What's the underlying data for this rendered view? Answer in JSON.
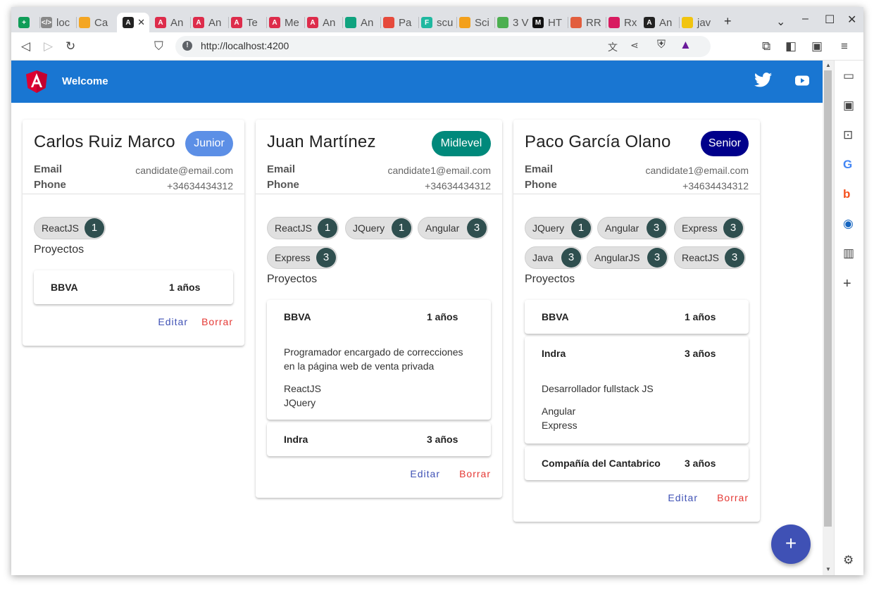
{
  "browser": {
    "tabs": [
      {
        "label": "",
        "color": "#0f9d58",
        "glyph": "+"
      },
      {
        "label": "loc",
        "color": "#888888",
        "glyph": "</>"
      },
      {
        "label": "Ca",
        "color": "#f4a623",
        "glyph": ""
      },
      {
        "label": "",
        "color": "#222222",
        "glyph": "A",
        "active": true
      },
      {
        "label": "An",
        "color": "#dd2c4b",
        "glyph": "A"
      },
      {
        "label": "An",
        "color": "#dd2c4b",
        "glyph": "A"
      },
      {
        "label": "Te",
        "color": "#dd2c4b",
        "glyph": "A"
      },
      {
        "label": "Me",
        "color": "#dd2c4b",
        "glyph": "A"
      },
      {
        "label": "An",
        "color": "#dd2c4b",
        "glyph": "A"
      },
      {
        "label": "An",
        "color": "#10a37f",
        "glyph": ""
      },
      {
        "label": "Pa",
        "color": "#e64a3c",
        "glyph": ""
      },
      {
        "label": "scu",
        "color": "#1fb8a0",
        "glyph": "F"
      },
      {
        "label": "Sci",
        "color": "#f3a01b",
        "glyph": ""
      },
      {
        "label": "3 V",
        "color": "#4caf50",
        "glyph": ""
      },
      {
        "label": "HT",
        "color": "#111111",
        "glyph": "M"
      },
      {
        "label": "RR",
        "color": "#e25e3e",
        "glyph": ""
      },
      {
        "label": "Rx",
        "color": "#d81b60",
        "glyph": ""
      },
      {
        "label": "An",
        "color": "#222222",
        "glyph": "A"
      },
      {
        "label": "jav",
        "color": "#f1c40f",
        "glyph": ""
      }
    ],
    "new_tab": "+",
    "url": "http://localhost:4200"
  },
  "app": {
    "title": "Welcome",
    "fab_label": "+"
  },
  "candidates": [
    {
      "name": "Carlos Ruiz Marco",
      "level": "Junior",
      "level_color": "#5c8fe6",
      "email_label": "Email",
      "email": "candidate@email.com",
      "phone_label": "Phone",
      "phone": "+34634434312",
      "skills": [
        {
          "name": "ReactJS",
          "years": "1"
        }
      ],
      "projects_title": "Proyectos",
      "projects": [
        {
          "name": "BBVA",
          "years": "1 años",
          "description": "",
          "tech": []
        }
      ],
      "edit_label": "Editar",
      "delete_label": "Borrar"
    },
    {
      "name": "Juan Martínez",
      "level": "Midlevel",
      "level_color": "#00897b",
      "email_label": "Email",
      "email": "candidate1@email.com",
      "phone_label": "Phone",
      "phone": "+34634434312",
      "skills": [
        {
          "name": "ReactJS",
          "years": "1"
        },
        {
          "name": "JQuery",
          "years": "1"
        },
        {
          "name": "Angular",
          "years": "3"
        },
        {
          "name": "Express",
          "years": "3"
        }
      ],
      "projects_title": "Proyectos",
      "projects": [
        {
          "name": "BBVA",
          "years": "1 años",
          "description": "Programador encargado de correcciones en la página web de venta privada",
          "tech": [
            "ReactJS",
            "JQuery"
          ]
        },
        {
          "name": "Indra",
          "years": "3 años",
          "description": "",
          "tech": []
        }
      ],
      "edit_label": "Editar",
      "delete_label": "Borrar"
    },
    {
      "name": "Paco García Olano",
      "level": "Senior",
      "level_color": "#00008b",
      "email_label": "Email",
      "email": "candidate1@email.com",
      "phone_label": "Phone",
      "phone": "+34634434312",
      "skills": [
        {
          "name": "JQuery",
          "years": "1"
        },
        {
          "name": "Angular",
          "years": "3"
        },
        {
          "name": "Express",
          "years": "3"
        },
        {
          "name": "Java",
          "years": "3"
        },
        {
          "name": "AngularJS",
          "years": "3"
        },
        {
          "name": "ReactJS",
          "years": "3"
        }
      ],
      "projects_title": "Proyectos",
      "projects": [
        {
          "name": "BBVA",
          "years": "1 años",
          "description": "",
          "tech": []
        },
        {
          "name": "Indra",
          "years": "3 años",
          "description": "Desarrollador fullstack JS",
          "tech": [
            "Angular",
            "Express"
          ]
        },
        {
          "name": "Compañía del Cantabrico",
          "years": "3 años",
          "description": "",
          "tech": []
        }
      ],
      "edit_label": "Editar",
      "delete_label": "Borrar"
    }
  ]
}
